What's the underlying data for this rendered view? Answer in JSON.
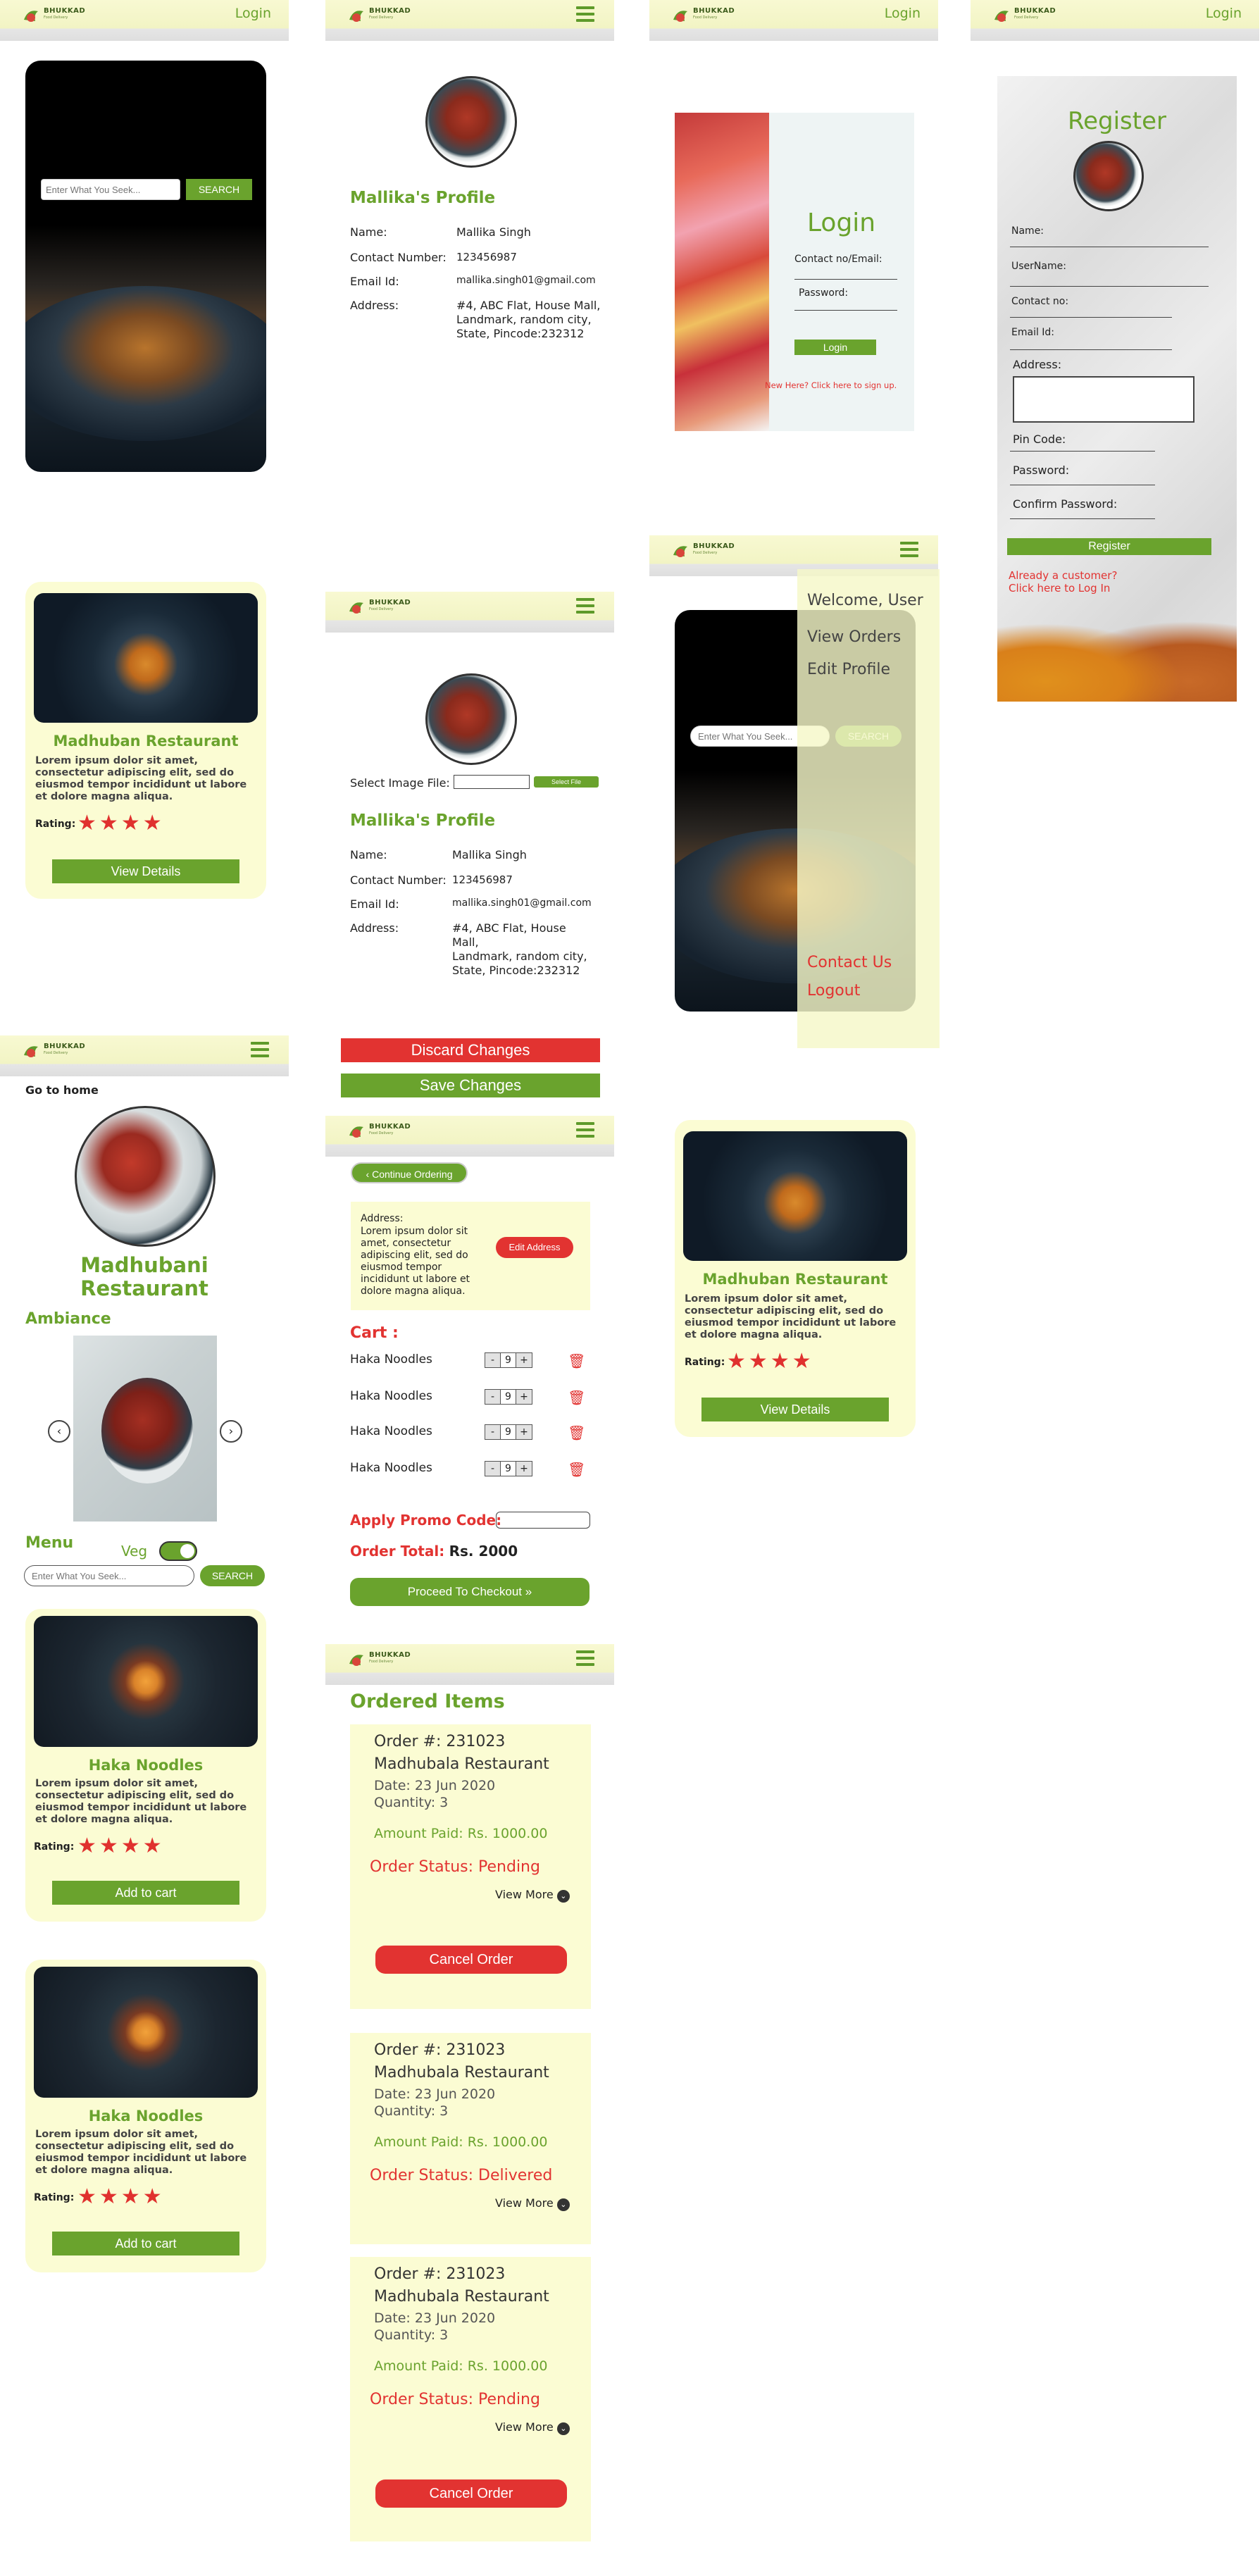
{
  "brand": {
    "name": "BHUKKAD",
    "tag": "Food Delivery"
  },
  "login_link": "Login",
  "search": {
    "placeholder": "Enter What You Seek...",
    "button": "SEARCH"
  },
  "profile": {
    "title": "Mallika's Profile",
    "name_label": "Name:",
    "name": "Mallika Singh",
    "contact_label": "Contact Number:",
    "contact": "123456987",
    "email_label": "Email Id:",
    "email": "mallika.singh01@gmail.com",
    "address_label": "Address:",
    "address1": "#4, ABC Flat, House Mall,",
    "address2": "Landmark, random city,",
    "address3": "State, Pincode:232312",
    "address_b1": "#4, ABC Flat, House",
    "address_b2": "Mall,",
    "address_b3": "Landmark, random city,",
    "address_b4": "State, Pincode:232312",
    "select_image_label": "Select Image File:",
    "select_file_btn": "Select File",
    "discard": "Discard Changes",
    "save": "Save Changes"
  },
  "login": {
    "title": "Login",
    "contact_label": "Contact no/Email:",
    "password_label": "Password:",
    "button": "Login",
    "signup": "New Here? Click here to sign up."
  },
  "register": {
    "title": "Register",
    "fields": [
      "Name:",
      "UserName:",
      "Contact no:",
      "Email Id:",
      "Address:",
      "Pin Code:",
      "Password:",
      "Confirm Password:"
    ],
    "button": "Register",
    "already1": "Already a customer?",
    "already2": "Click here to Log In"
  },
  "menu_overlay": {
    "welcome": "Welcome, User",
    "view_orders": "View Orders",
    "edit_profile": "Edit Profile",
    "contact_us": "Contact Us",
    "logout": "Logout"
  },
  "restaurant_card": {
    "name": "Madhuban Restaurant",
    "desc": "Lorem ipsum dolor sit amet, consectetur adipiscing elit, sed do eiusmod tempor incididunt ut labore et dolore magna aliqua.",
    "rating_label": "Rating:",
    "button": "View Details"
  },
  "restaurant_page": {
    "go_home": "Go to home",
    "name1": "Madhubani",
    "name2": "Restaurant",
    "ambiance": "Ambiance",
    "menu": "Menu",
    "veg": "Veg"
  },
  "dish_card": {
    "name": "Haka Noodles",
    "desc": "Lorem ipsum dolor sit amet, consectetur adipiscing elit, sed do eiusmod tempor incididunt ut labore et dolore magna aliqua.",
    "rating_label": "Rating:",
    "button": "Add to cart"
  },
  "cart": {
    "continue": "Continue Ordering",
    "address_label": "Address:",
    "address_text": "Lorem ipsum dolor sit amet, consectetur adipiscing elit, sed do eiusmod tempor incididunt ut labore et dolore magna aliqua.",
    "edit_address": "Edit Address",
    "title": "Cart :",
    "items": [
      {
        "name": "Haka Noodles",
        "qty": "9"
      },
      {
        "name": "Haka Noodles",
        "qty": "9"
      },
      {
        "name": "Haka Noodles",
        "qty": "9"
      },
      {
        "name": "Haka Noodles",
        "qty": "9"
      }
    ],
    "minus": "-",
    "plus": "+",
    "promo_label": "Apply Promo Code:",
    "total_label": "Order Total:",
    "total": "Rs. 2000",
    "checkout": "Proceed To Checkout"
  },
  "orders": {
    "title": "Ordered Items",
    "list": [
      {
        "no": "Order #: 231023",
        "rest": "Madhubala Restaurant",
        "date": "Date: 23 Jun 2020",
        "qty": "Quantity: 3",
        "paid": "Amount Paid: Rs. 1000.00",
        "status": "Order Status: Pending",
        "more": "View More",
        "cancel": "Cancel Order"
      },
      {
        "no": "Order #: 231023",
        "rest": "Madhubala Restaurant",
        "date": "Date: 23 Jun 2020",
        "qty": "Quantity: 3",
        "paid": "Amount Paid: Rs. 1000.00",
        "status": "Order Status: Delivered",
        "more": "View More"
      },
      {
        "no": "Order #: 231023",
        "rest": "Madhubala Restaurant",
        "date": "Date: 23 Jun 2020",
        "qty": "Quantity: 3",
        "paid": "Amount Paid: Rs. 1000.00",
        "status": "Order Status: Pending",
        "more": "View More",
        "cancel": "Cancel Order"
      }
    ]
  },
  "colors": {
    "accent": "#6aa32d",
    "danger": "#e23331",
    "card": "#fbfcd3",
    "header": "#f2f4c4"
  },
  "rating": {
    "stars": 4,
    "max": 4
  }
}
